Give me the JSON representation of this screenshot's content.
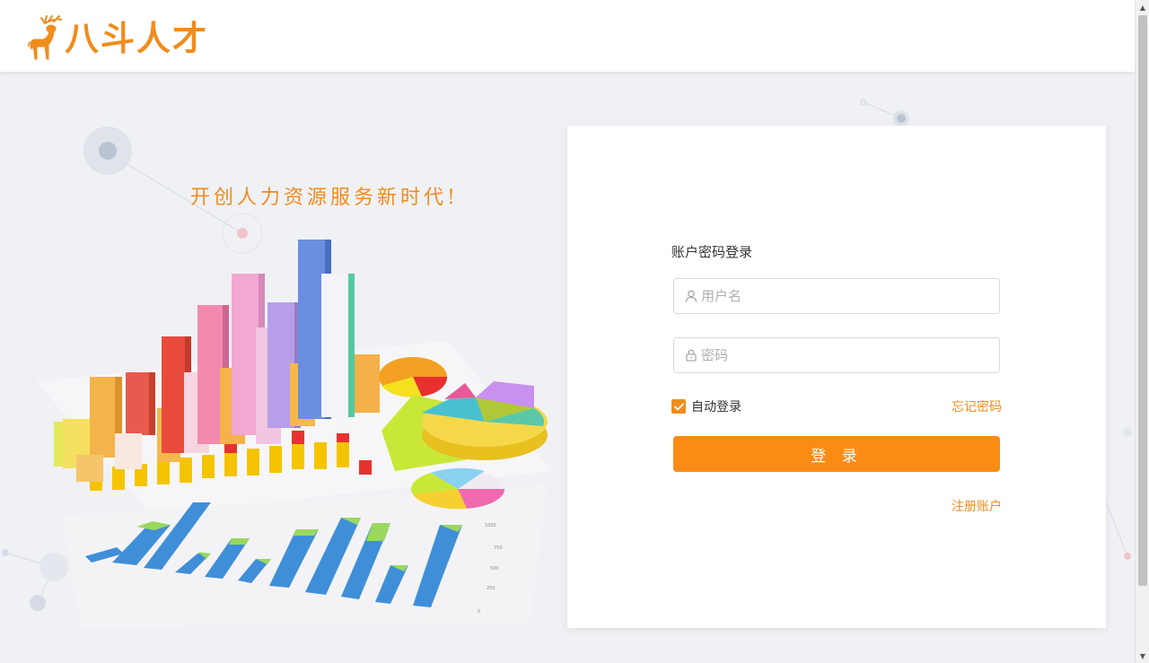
{
  "brand": {
    "name": "八斗人才",
    "logo_icon": "deer-icon",
    "color": "#f08c1d"
  },
  "hero": {
    "slogan": "开创人力资源服务新时代!"
  },
  "login": {
    "title": "账户密码登录",
    "username": {
      "placeholder": "用户名",
      "value": "",
      "icon": "user-icon"
    },
    "password": {
      "placeholder": "密码",
      "value": "",
      "icon": "lock-icon"
    },
    "auto_login": {
      "label": "自动登录",
      "checked": true
    },
    "forgot_label": "忘记密码",
    "submit_label": "登 录",
    "register_label": "注册账户",
    "accent_color": "#fa8c16"
  }
}
